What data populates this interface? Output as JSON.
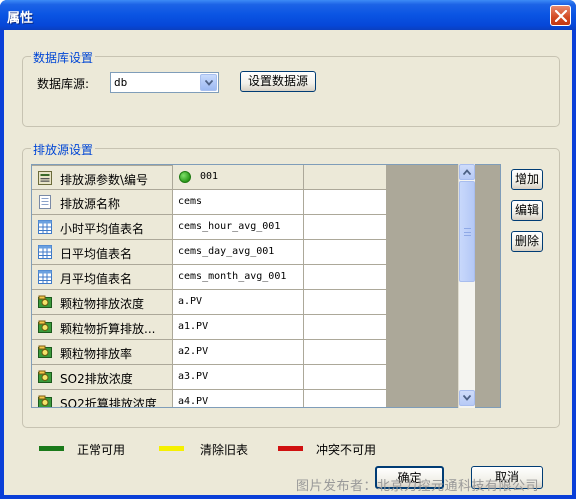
{
  "window": {
    "title": "属性",
    "close_icon": "close-icon"
  },
  "db_group": {
    "legend": "数据库设置",
    "source_label": "数据库源:",
    "source_value": "db",
    "settings_button": "设置数据源"
  },
  "emission_group": {
    "legend": "排放源设置",
    "rows": [
      {
        "name": "排放源参数\\编号",
        "value": "001",
        "icon": "id-card-icon",
        "status": "green-dot"
      },
      {
        "name": "排放源名称",
        "value": "cems",
        "icon": "document-icon"
      },
      {
        "name": "小时平均值表名",
        "value": "cems_hour_avg_001",
        "icon": "table-icon"
      },
      {
        "name": "日平均值表名",
        "value": "cems_day_avg_001",
        "icon": "table-icon"
      },
      {
        "name": "月平均值表名",
        "value": "cems_month_avg_001",
        "icon": "table-icon"
      },
      {
        "name": "颗粒物排放浓度",
        "value": "a.PV",
        "icon": "money-icon"
      },
      {
        "name": "颗粒物折算排放...",
        "value": "a1.PV",
        "icon": "money-icon"
      },
      {
        "name": "颗粒物排放率",
        "value": "a2.PV",
        "icon": "money-icon"
      },
      {
        "name": "SO2排放浓度",
        "value": "a3.PV",
        "icon": "money-icon"
      },
      {
        "name": "SO2折算排放浓度",
        "value": "a4.PV",
        "icon": "money-icon"
      }
    ],
    "buttons": {
      "add": "增加",
      "edit": "编辑",
      "delete": "删除"
    }
  },
  "legend": [
    {
      "label": "正常可用",
      "color": "#1a7a1a"
    },
    {
      "label": "清除旧表",
      "color": "#f5f000"
    },
    {
      "label": "冲突不可用",
      "color": "#d01010"
    }
  ],
  "footer": {
    "ok": "确定",
    "cancel": "取消"
  },
  "watermark": "图片发布者：北京力控元通科技有限公司"
}
